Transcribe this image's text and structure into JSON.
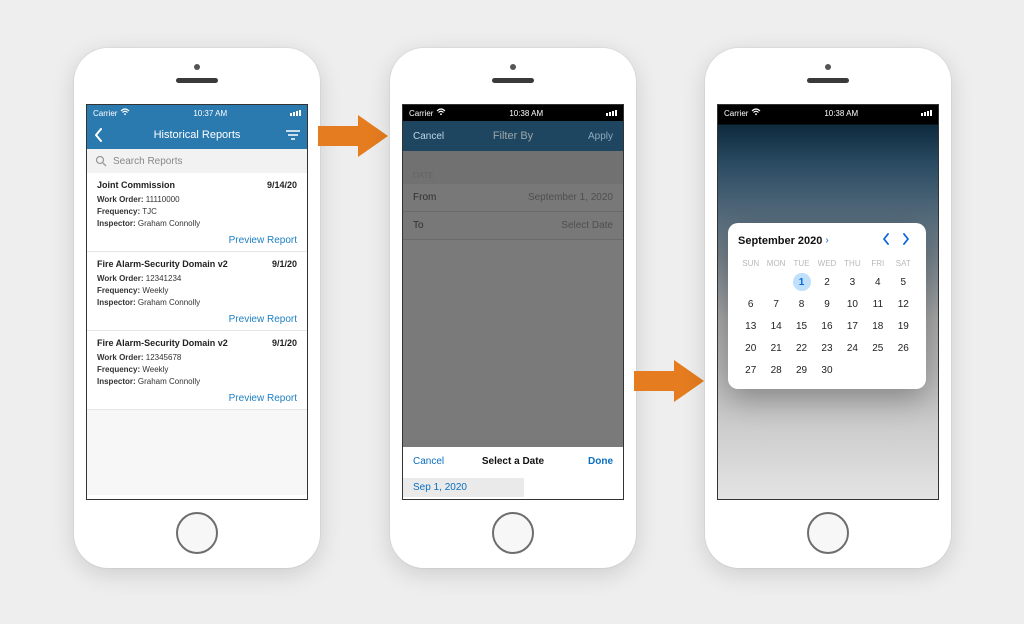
{
  "phone1": {
    "status": {
      "carrier": "Carrier",
      "wifi": true,
      "time": "10:37 AM"
    },
    "nav": {
      "title": "Historical Reports"
    },
    "search": {
      "placeholder": "Search Reports"
    },
    "reports": [
      {
        "title": "Joint Commission",
        "date": "9/14/20",
        "work_order_label": "Work Order:",
        "work_order": "11110000",
        "frequency_label": "Frequency:",
        "frequency": "TJC",
        "inspector_label": "Inspector:",
        "inspector": "Graham Connolly",
        "link": "Preview Report"
      },
      {
        "title": "Fire Alarm-Security Domain v2",
        "date": "9/1/20",
        "work_order_label": "Work Order:",
        "work_order": "12341234",
        "frequency_label": "Frequency:",
        "frequency": "Weekly",
        "inspector_label": "Inspector:",
        "inspector": "Graham Connolly",
        "link": "Preview Report"
      },
      {
        "title": "Fire Alarm-Security Domain v2",
        "date": "9/1/20",
        "work_order_label": "Work Order:",
        "work_order": "12345678",
        "frequency_label": "Frequency:",
        "frequency": "Weekly",
        "inspector_label": "Inspector:",
        "inspector": "Graham Connolly",
        "link": "Preview Report"
      }
    ]
  },
  "phone2": {
    "status": {
      "carrier": "Carrier",
      "wifi": true,
      "time": "10:38 AM"
    },
    "nav": {
      "cancel": "Cancel",
      "title": "Filter By",
      "apply": "Apply"
    },
    "section": "DATE",
    "rows": {
      "from_label": "From",
      "from_value": "September 1, 2020",
      "to_label": "To",
      "to_value": "Select Date"
    },
    "sheet": {
      "cancel": "Cancel",
      "title": "Select a Date",
      "done": "Done",
      "value": "Sep 1, 2020"
    }
  },
  "phone3": {
    "status": {
      "carrier": "Carrier",
      "wifi": true,
      "time": "10:38 AM"
    },
    "calendar": {
      "month": "September 2020",
      "dow": [
        "SUN",
        "MON",
        "TUE",
        "WED",
        "THU",
        "FRI",
        "SAT"
      ],
      "selected": 1,
      "grid": [
        [
          "",
          "",
          1,
          2,
          3,
          4,
          5
        ],
        [
          6,
          7,
          8,
          9,
          10,
          11,
          12
        ],
        [
          13,
          14,
          15,
          16,
          17,
          18,
          19
        ],
        [
          20,
          21,
          22,
          23,
          24,
          25,
          26
        ],
        [
          27,
          28,
          29,
          30,
          "",
          "",
          ""
        ]
      ]
    }
  },
  "colors": {
    "brand": "#2a7aaf",
    "link": "#1e7fc2",
    "arrow": "#e57c1f",
    "ios_blue": "#0a66d6"
  }
}
